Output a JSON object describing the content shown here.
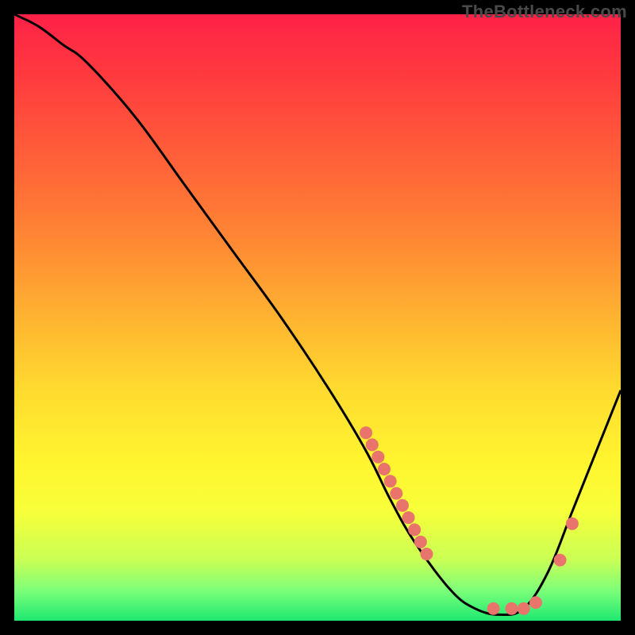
{
  "watermark": "TheBottleneck.com",
  "chart_data": {
    "type": "line",
    "title": "",
    "xlabel": "",
    "ylabel": "",
    "xlim": [
      0,
      100
    ],
    "ylim": [
      0,
      100
    ],
    "grid": false,
    "legend": false,
    "series": [
      {
        "name": "curve",
        "x": [
          0,
          4,
          8,
          12,
          20,
          28,
          36,
          44,
          52,
          58,
          62,
          66,
          72,
          76,
          80,
          84,
          88,
          92,
          96,
          100
        ],
        "y": [
          100,
          98,
          95,
          92,
          83,
          72,
          61,
          50,
          38,
          28,
          20,
          13,
          5,
          2,
          1,
          2,
          8,
          18,
          28,
          38
        ]
      }
    ],
    "markers": [
      {
        "x": 58,
        "y": 31
      },
      {
        "x": 59,
        "y": 29
      },
      {
        "x": 60,
        "y": 27
      },
      {
        "x": 61,
        "y": 25
      },
      {
        "x": 62,
        "y": 23
      },
      {
        "x": 63,
        "y": 21
      },
      {
        "x": 64,
        "y": 19
      },
      {
        "x": 65,
        "y": 17
      },
      {
        "x": 66,
        "y": 15
      },
      {
        "x": 67,
        "y": 13
      },
      {
        "x": 68,
        "y": 11
      },
      {
        "x": 79,
        "y": 2
      },
      {
        "x": 82,
        "y": 2
      },
      {
        "x": 84,
        "y": 2
      },
      {
        "x": 86,
        "y": 3
      },
      {
        "x": 90,
        "y": 10
      },
      {
        "x": 92,
        "y": 16
      }
    ],
    "colors": {
      "curve_stroke": "#000000",
      "marker_fill": "#e9746b"
    }
  }
}
